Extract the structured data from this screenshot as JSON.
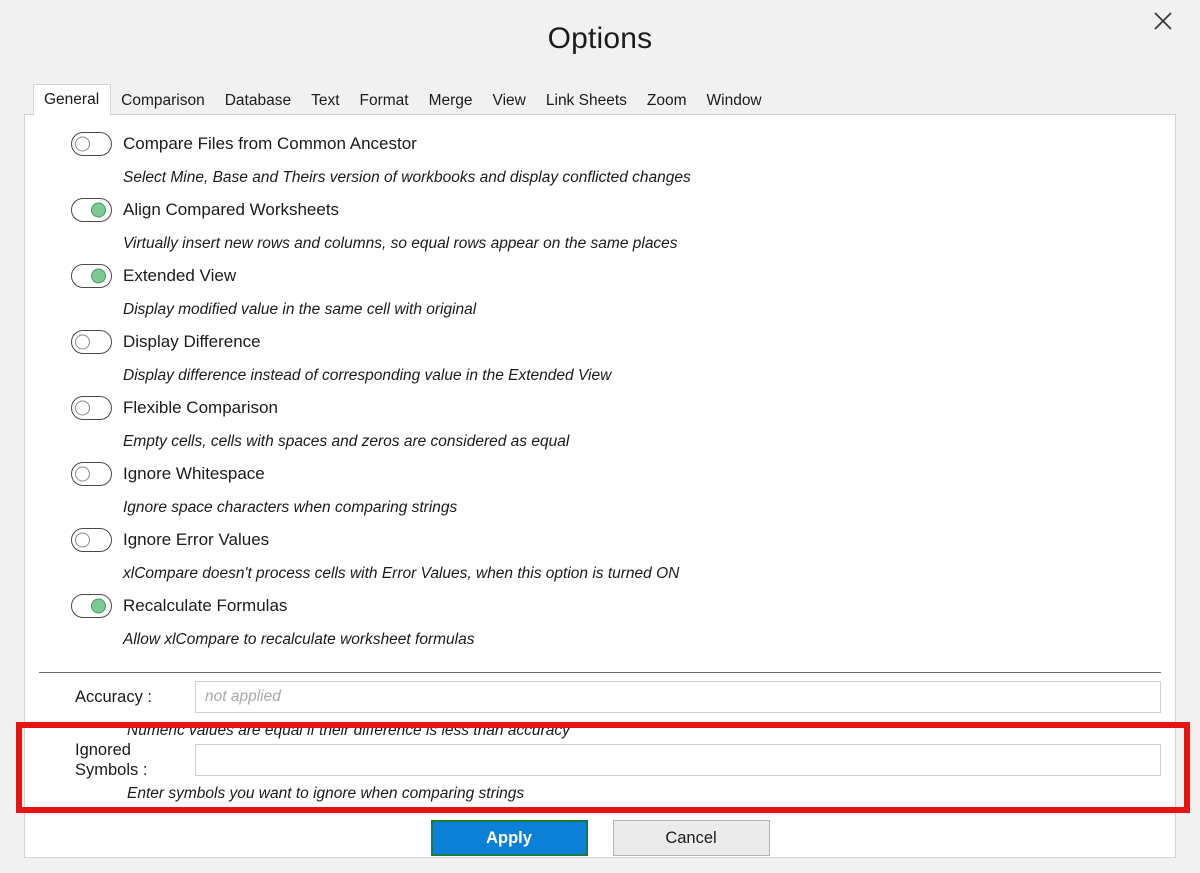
{
  "dialog": {
    "title": "Options",
    "close_icon": "close-icon"
  },
  "tabs": [
    {
      "label": "General",
      "active": true
    },
    {
      "label": "Comparison",
      "active": false
    },
    {
      "label": "Database",
      "active": false
    },
    {
      "label": "Text",
      "active": false
    },
    {
      "label": "Format",
      "active": false
    },
    {
      "label": "Merge",
      "active": false
    },
    {
      "label": "View",
      "active": false
    },
    {
      "label": "Link Sheets",
      "active": false
    },
    {
      "label": "Zoom",
      "active": false
    },
    {
      "label": "Window",
      "active": false
    }
  ],
  "options": [
    {
      "label": "Compare Files from Common Ancestor",
      "description": "Select Mine, Base and Theirs version of workbooks and display conflicted changes",
      "state": "off"
    },
    {
      "label": "Align Compared Worksheets",
      "description": "Virtually insert new rows and columns, so equal rows appear on the same places",
      "state": "on"
    },
    {
      "label": "Extended View",
      "description": "Display modified value in the same cell with original",
      "state": "on"
    },
    {
      "label": "Display Difference",
      "description": "Display difference instead of corresponding value in the Extended View",
      "state": "off"
    },
    {
      "label": "Flexible Comparison",
      "description": "Empty cells, cells with spaces and zeros are considered as equal",
      "state": "off"
    },
    {
      "label": "Ignore Whitespace",
      "description": "Ignore space characters when comparing strings",
      "state": "off"
    },
    {
      "label": "Ignore Error Values",
      "description": "xlCompare doesn't process cells with Error Values, when this option is turned ON",
      "state": "off"
    },
    {
      "label": "Recalculate Formulas",
      "description": "Allow xlCompare to recalculate worksheet formulas",
      "state": "on"
    }
  ],
  "fields": {
    "accuracy": {
      "label": "Accuracy :",
      "value": "",
      "placeholder": "not applied",
      "description": "Numeric values are equal if their difference is less than accuracy"
    },
    "ignored_symbols": {
      "label": "Ignored Symbols :",
      "value": "",
      "placeholder": "",
      "description": "Enter symbols you want to ignore when comparing strings"
    }
  },
  "footer": {
    "apply_label": "Apply",
    "cancel_label": "Cancel"
  },
  "colors": {
    "highlight": "#e51515",
    "apply_background": "#0c80d6",
    "apply_border": "#1a7a42",
    "toggle_on_knob": "#7dc894",
    "toggle_on_knob_border": "#3f9e63",
    "panel_background": "#ffffff",
    "dialog_background": "#f1f1f1"
  }
}
